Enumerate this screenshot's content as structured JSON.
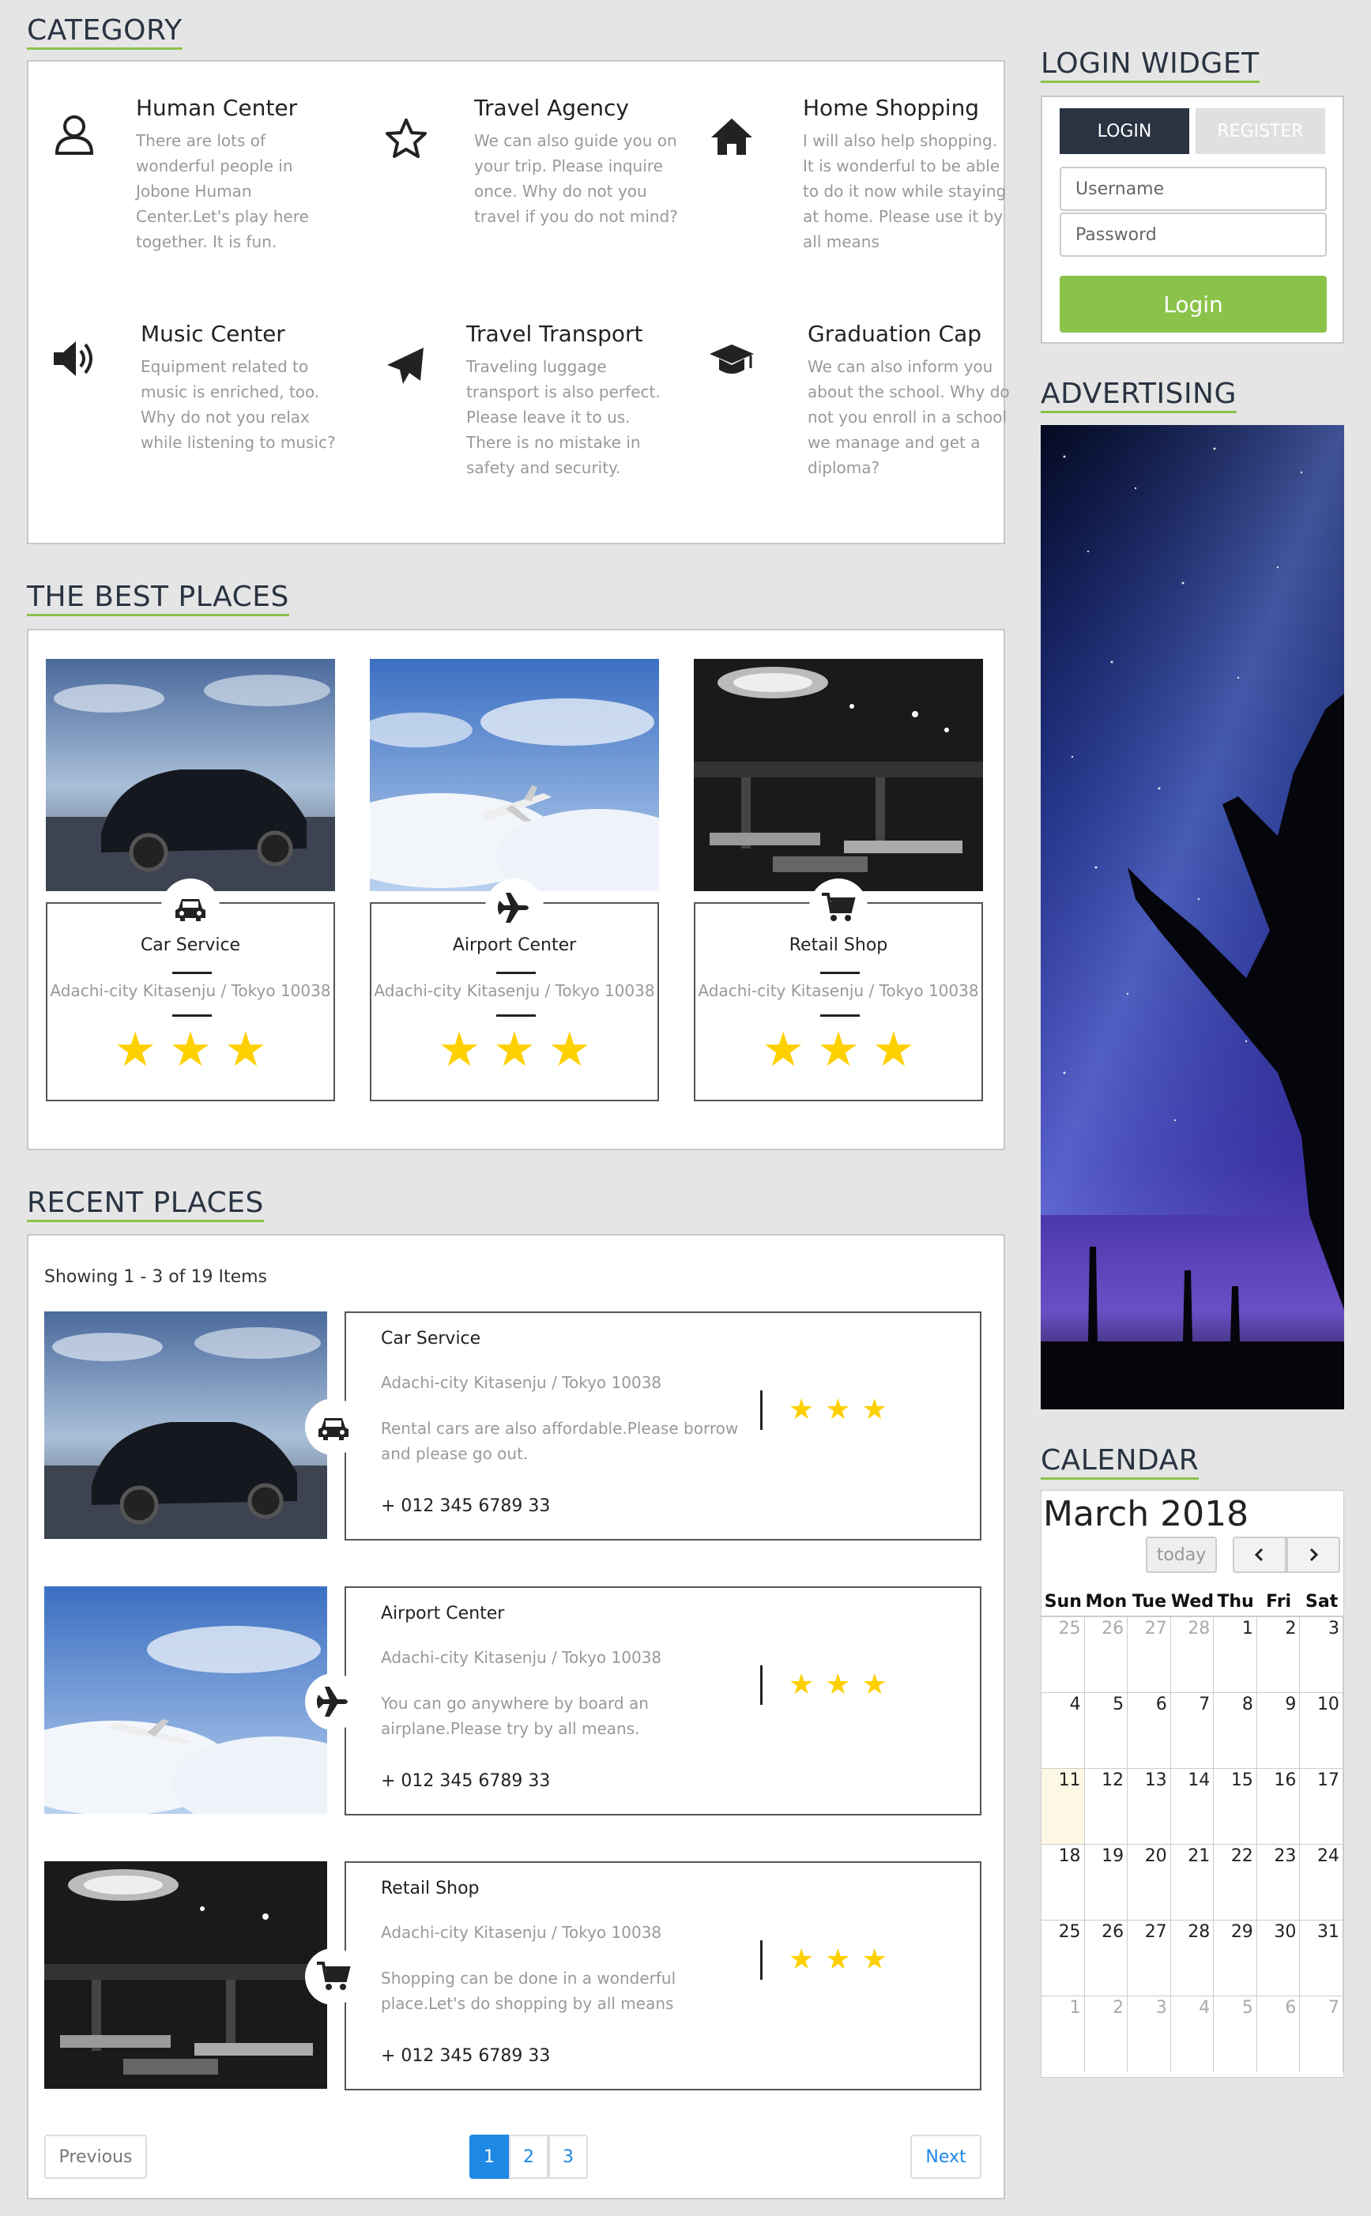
{
  "category": {
    "heading": "CATEGORY",
    "items": [
      {
        "icon": "user-icon",
        "title": "Human Center",
        "desc": "There are lots of wonderful people in Jobone Human Center.Let's play here together. It is fun."
      },
      {
        "icon": "star-icon",
        "title": "Travel Agency",
        "desc": "We can also guide you on your trip. Please inquire once. Why do not you travel if you do not mind?"
      },
      {
        "icon": "home-icon",
        "title": "Home Shopping",
        "desc": "I will also help shopping. It is wonderful to be able to do it now while staying at home. Please use it by all means"
      },
      {
        "icon": "volume-icon",
        "title": "Music Center",
        "desc": "Equipment related to music is enriched, too. Why do not you relax while listening to music?"
      },
      {
        "icon": "paper-plane-icon",
        "title": "Travel Transport",
        "desc": "Traveling luggage transport is also perfect. Please leave it to us. There is no mistake in safety and security."
      },
      {
        "icon": "graduation-cap-icon",
        "title": "Graduation Cap",
        "desc": "We can also inform you about the school. Why do not you enroll in a school we manage and get a diploma?"
      }
    ]
  },
  "best": {
    "heading": "THE BEST PLACES",
    "cards": [
      {
        "icon": "car-icon",
        "name": "Car Service",
        "addr": "Adachi-city Kitasenju / Tokyo 10038",
        "stars": 3
      },
      {
        "icon": "plane-icon",
        "name": "Airport Center",
        "addr": "Adachi-city Kitasenju / Tokyo 10038",
        "stars": 3
      },
      {
        "icon": "cart-icon",
        "name": "Retail Shop",
        "addr": "Adachi-city Kitasenju / Tokyo 10038",
        "stars": 3
      }
    ]
  },
  "recent": {
    "heading": "RECENT PLACES",
    "showing": "Showing 1 - 3 of 19 Items",
    "rows": [
      {
        "icon": "car-icon",
        "name": "Car Service",
        "addr": "Adachi-city Kitasenju / Tokyo 10038",
        "desc": "Rental cars are also affordable.Please borrow and please go out.",
        "phone": "+ 012 345 6789 33",
        "stars": 3
      },
      {
        "icon": "plane-icon",
        "name": "Airport Center",
        "addr": "Adachi-city Kitasenju / Tokyo 10038",
        "desc": "You can go anywhere by board an airplane.Please try by all means.",
        "phone": "+ 012 345 6789 33",
        "stars": 3
      },
      {
        "icon": "cart-icon",
        "name": "Retail Shop",
        "addr": "Adachi-city Kitasenju / Tokyo 10038",
        "desc": "Shopping can be done in a wonderful place.Let's do shopping by all means",
        "phone": "+ 012 345 6789 33",
        "stars": 3
      }
    ],
    "pagination": {
      "prev": "Previous",
      "next": "Next",
      "pages": [
        "1",
        "2",
        "3"
      ],
      "active": "1"
    }
  },
  "login": {
    "heading": "LOGIN WIDGET",
    "tab_login": "LOGIN",
    "tab_register": "REGISTER",
    "username_placeholder": "Username",
    "password_placeholder": "Password",
    "submit": "Login"
  },
  "advertising": {
    "heading": "ADVERTISING"
  },
  "calendar": {
    "heading": "CALENDAR",
    "title": "March 2018",
    "today_label": "today",
    "prev_icon": "chevron-left-icon",
    "next_icon": "chevron-right-icon",
    "weekdays": [
      "Sun",
      "Mon",
      "Tue",
      "Wed",
      "Thu",
      "Fri",
      "Sat"
    ],
    "weeks": [
      [
        "25",
        "26",
        "27",
        "28",
        "1",
        "2",
        "3"
      ],
      [
        "4",
        "5",
        "6",
        "7",
        "8",
        "9",
        "10"
      ],
      [
        "11",
        "12",
        "13",
        "14",
        "15",
        "16",
        "17"
      ],
      [
        "18",
        "19",
        "20",
        "21",
        "22",
        "23",
        "24"
      ],
      [
        "25",
        "26",
        "27",
        "28",
        "29",
        "30",
        "31"
      ],
      [
        "1",
        "2",
        "3",
        "4",
        "5",
        "6",
        "7"
      ]
    ],
    "today": "11"
  },
  "colors": {
    "accent": "#8bc34a",
    "navy": "#2a3342",
    "star": "#ffd000",
    "link": "#1e88e5"
  }
}
